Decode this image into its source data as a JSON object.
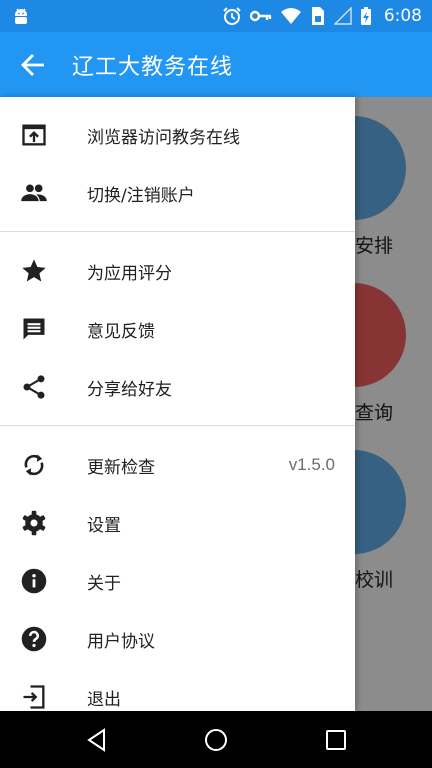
{
  "status_bar": {
    "time": "6:08",
    "icons": [
      "android-icon",
      "alarm-icon",
      "key-icon",
      "wifi-icon",
      "sim-icon",
      "signal-icon",
      "battery-charging-icon"
    ]
  },
  "app_bar": {
    "title": "辽工大教务在线",
    "back_icon": "arrow-back-icon"
  },
  "background": {
    "tiles": [
      {
        "label": "安排",
        "color": "#5FA8E0"
      },
      {
        "label": "查询",
        "color": "#E85B5B"
      },
      {
        "label": "校训",
        "color": "#5FA8E0"
      }
    ]
  },
  "drawer": {
    "groups": [
      [
        {
          "label": "浏览器访问教务在线",
          "icon": "open-in-browser-icon"
        },
        {
          "label": "切换/注销账户",
          "icon": "people-icon"
        }
      ],
      [
        {
          "label": "为应用评分",
          "icon": "star-icon"
        },
        {
          "label": "意见反馈",
          "icon": "feedback-icon"
        },
        {
          "label": "分享给好友",
          "icon": "share-icon"
        }
      ],
      [
        {
          "label": "更新检查",
          "icon": "sync-icon",
          "value": "v1.5.0"
        },
        {
          "label": "设置",
          "icon": "settings-gear-icon"
        },
        {
          "label": "关于",
          "icon": "info-icon"
        },
        {
          "label": "用户协议",
          "icon": "help-icon"
        },
        {
          "label": "退出",
          "icon": "exit-icon"
        }
      ]
    ]
  },
  "nav_bar": {
    "buttons": [
      "back-triangle-icon",
      "home-circle-icon",
      "recents-square-icon"
    ]
  },
  "colors": {
    "primary": "#2196F3",
    "primary_dark": "#1E88E5",
    "icon": "#212121"
  }
}
